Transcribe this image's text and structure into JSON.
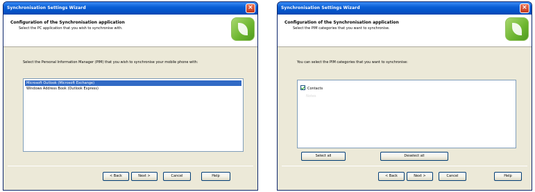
{
  "left_window": {
    "title": "Synchronisation Settings Wizard",
    "close_glyph": "×",
    "header_title": "Configuration of the Synchronisation application",
    "header_subtitle": "Select the PC application that you wish to synchronise with.",
    "instruction": "Select the Personal Information Manager (PIM) that you wish to synchronise your mobile phone with:",
    "list_items": [
      "Microsoft Outlook (Microsoft Exchange)",
      "Windows Address Book (Outlook Express)"
    ],
    "selected_index": 0,
    "buttons": {
      "back": "< Back",
      "next": "Next >",
      "cancel": "Cancel",
      "help": "Help"
    }
  },
  "right_window": {
    "title": "Synchronisation Settings Wizard",
    "close_glyph": "×",
    "header_title": "Configuration of the Synchronisation application",
    "header_subtitle": "Select the PIM categories that you want to synchronise.",
    "instruction": "You can select the PIM categories that you want to synchronise:",
    "categories": [
      {
        "label": "Contacts",
        "checked": true
      }
    ],
    "faint_entry": "Notes",
    "select_all": "Select all",
    "deselect_all": "Deselect all",
    "buttons": {
      "back": "< Back",
      "next": "Next >",
      "cancel": "Cancel",
      "help": "Help"
    }
  },
  "colors": {
    "titlebar": "#0a5fd6",
    "selection": "#316ac5",
    "window_bg": "#ece9d8",
    "logo": "#6cb52f"
  },
  "icons": [
    "close-icon",
    "sync-logo-icon",
    "checkbox-checked-icon"
  ]
}
